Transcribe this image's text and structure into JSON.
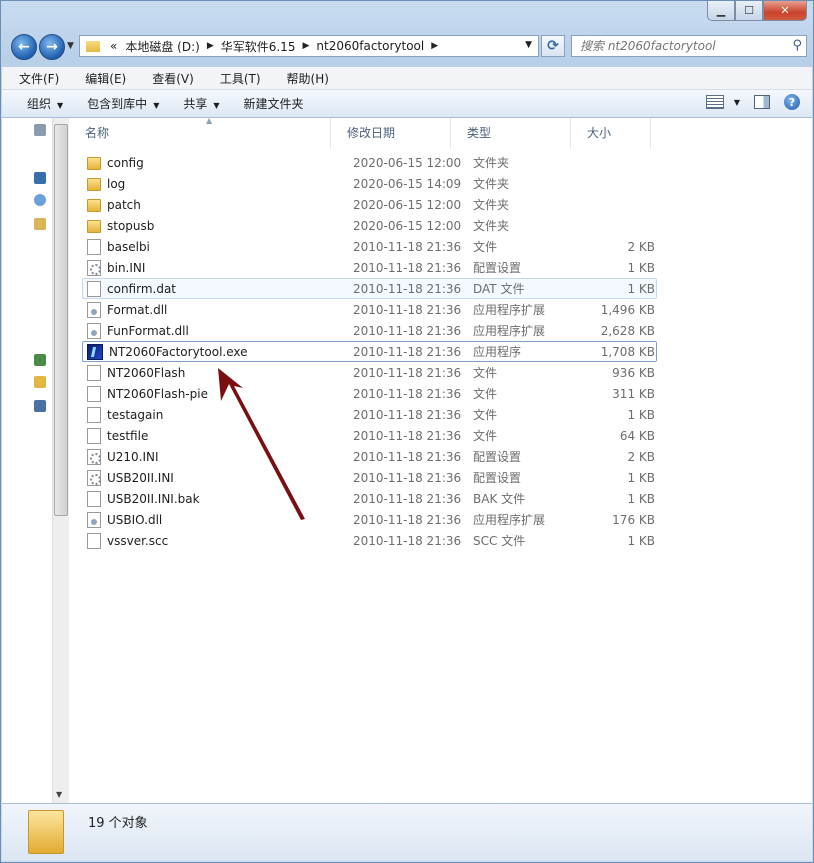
{
  "address": {
    "overflow": "«",
    "crumbs": [
      "本地磁盘 (D:)",
      "华军软件6.15",
      "nt2060factorytool"
    ]
  },
  "search": {
    "placeholder": "搜索 nt2060factorytool"
  },
  "menu": [
    "文件(F)",
    "编辑(E)",
    "查看(V)",
    "工具(T)",
    "帮助(H)"
  ],
  "toolbar": [
    "组织",
    "包含到库中",
    "共享",
    "新建文件夹"
  ],
  "columns": [
    "名称",
    "修改日期",
    "类型",
    "大小"
  ],
  "files": [
    {
      "name": "config",
      "date": "2020-06-15 12:00",
      "type": "文件夹",
      "size": "",
      "icon": "folder-icon"
    },
    {
      "name": "log",
      "date": "2020-06-15 14:09",
      "type": "文件夹",
      "size": "",
      "icon": "folder-icon"
    },
    {
      "name": "patch",
      "date": "2020-06-15 12:00",
      "type": "文件夹",
      "size": "",
      "icon": "folder-icon"
    },
    {
      "name": "stopusb",
      "date": "2020-06-15 12:00",
      "type": "文件夹",
      "size": "",
      "icon": "folder-icon"
    },
    {
      "name": "baselbi",
      "date": "2010-11-18 21:36",
      "type": "文件",
      "size": "2 KB",
      "icon": "file-icon"
    },
    {
      "name": "bin.INI",
      "date": "2010-11-18 21:36",
      "type": "配置设置",
      "size": "1 KB",
      "icon": "settings-file-icon"
    },
    {
      "name": "confirm.dat",
      "date": "2010-11-18 21:36",
      "type": "DAT 文件",
      "size": "1 KB",
      "icon": "file-icon"
    },
    {
      "name": "Format.dll",
      "date": "2010-11-18 21:36",
      "type": "应用程序扩展",
      "size": "1,496 KB",
      "icon": "dll-file-icon"
    },
    {
      "name": "FunFormat.dll",
      "date": "2010-11-18 21:36",
      "type": "应用程序扩展",
      "size": "2,628 KB",
      "icon": "dll-file-icon"
    },
    {
      "name": "NT2060Factorytool.exe",
      "date": "2010-11-18 21:36",
      "type": "应用程序",
      "size": "1,708 KB",
      "icon": "exe-app-icon"
    },
    {
      "name": "NT2060Flash",
      "date": "2010-11-18 21:36",
      "type": "文件",
      "size": "936 KB",
      "icon": "file-icon"
    },
    {
      "name": "NT2060Flash-pie",
      "date": "2010-11-18 21:36",
      "type": "文件",
      "size": "311 KB",
      "icon": "file-icon"
    },
    {
      "name": "testagain",
      "date": "2010-11-18 21:36",
      "type": "文件",
      "size": "1 KB",
      "icon": "file-icon"
    },
    {
      "name": "testfile",
      "date": "2010-11-18 21:36",
      "type": "文件",
      "size": "64 KB",
      "icon": "file-icon"
    },
    {
      "name": "U210.INI",
      "date": "2010-11-18 21:36",
      "type": "配置设置",
      "size": "2 KB",
      "icon": "settings-file-icon"
    },
    {
      "name": "USB20II.INI",
      "date": "2010-11-18 21:36",
      "type": "配置设置",
      "size": "1 KB",
      "icon": "settings-file-icon"
    },
    {
      "name": "USB20II.INI.bak",
      "date": "2010-11-18 21:36",
      "type": "BAK 文件",
      "size": "1 KB",
      "icon": "file-icon"
    },
    {
      "name": "USBIO.dll",
      "date": "2010-11-18 21:36",
      "type": "应用程序扩展",
      "size": "176 KB",
      "icon": "dll-file-icon"
    },
    {
      "name": "vssver.scc",
      "date": "2010-11-18 21:36",
      "type": "SCC 文件",
      "size": "1 KB",
      "icon": "file-icon"
    }
  ],
  "status": {
    "count": "19 个对象"
  },
  "colors": {
    "annotation_arrow": "#7a0f12",
    "folder": "#e5b43a",
    "accent": "#2f69a8"
  }
}
